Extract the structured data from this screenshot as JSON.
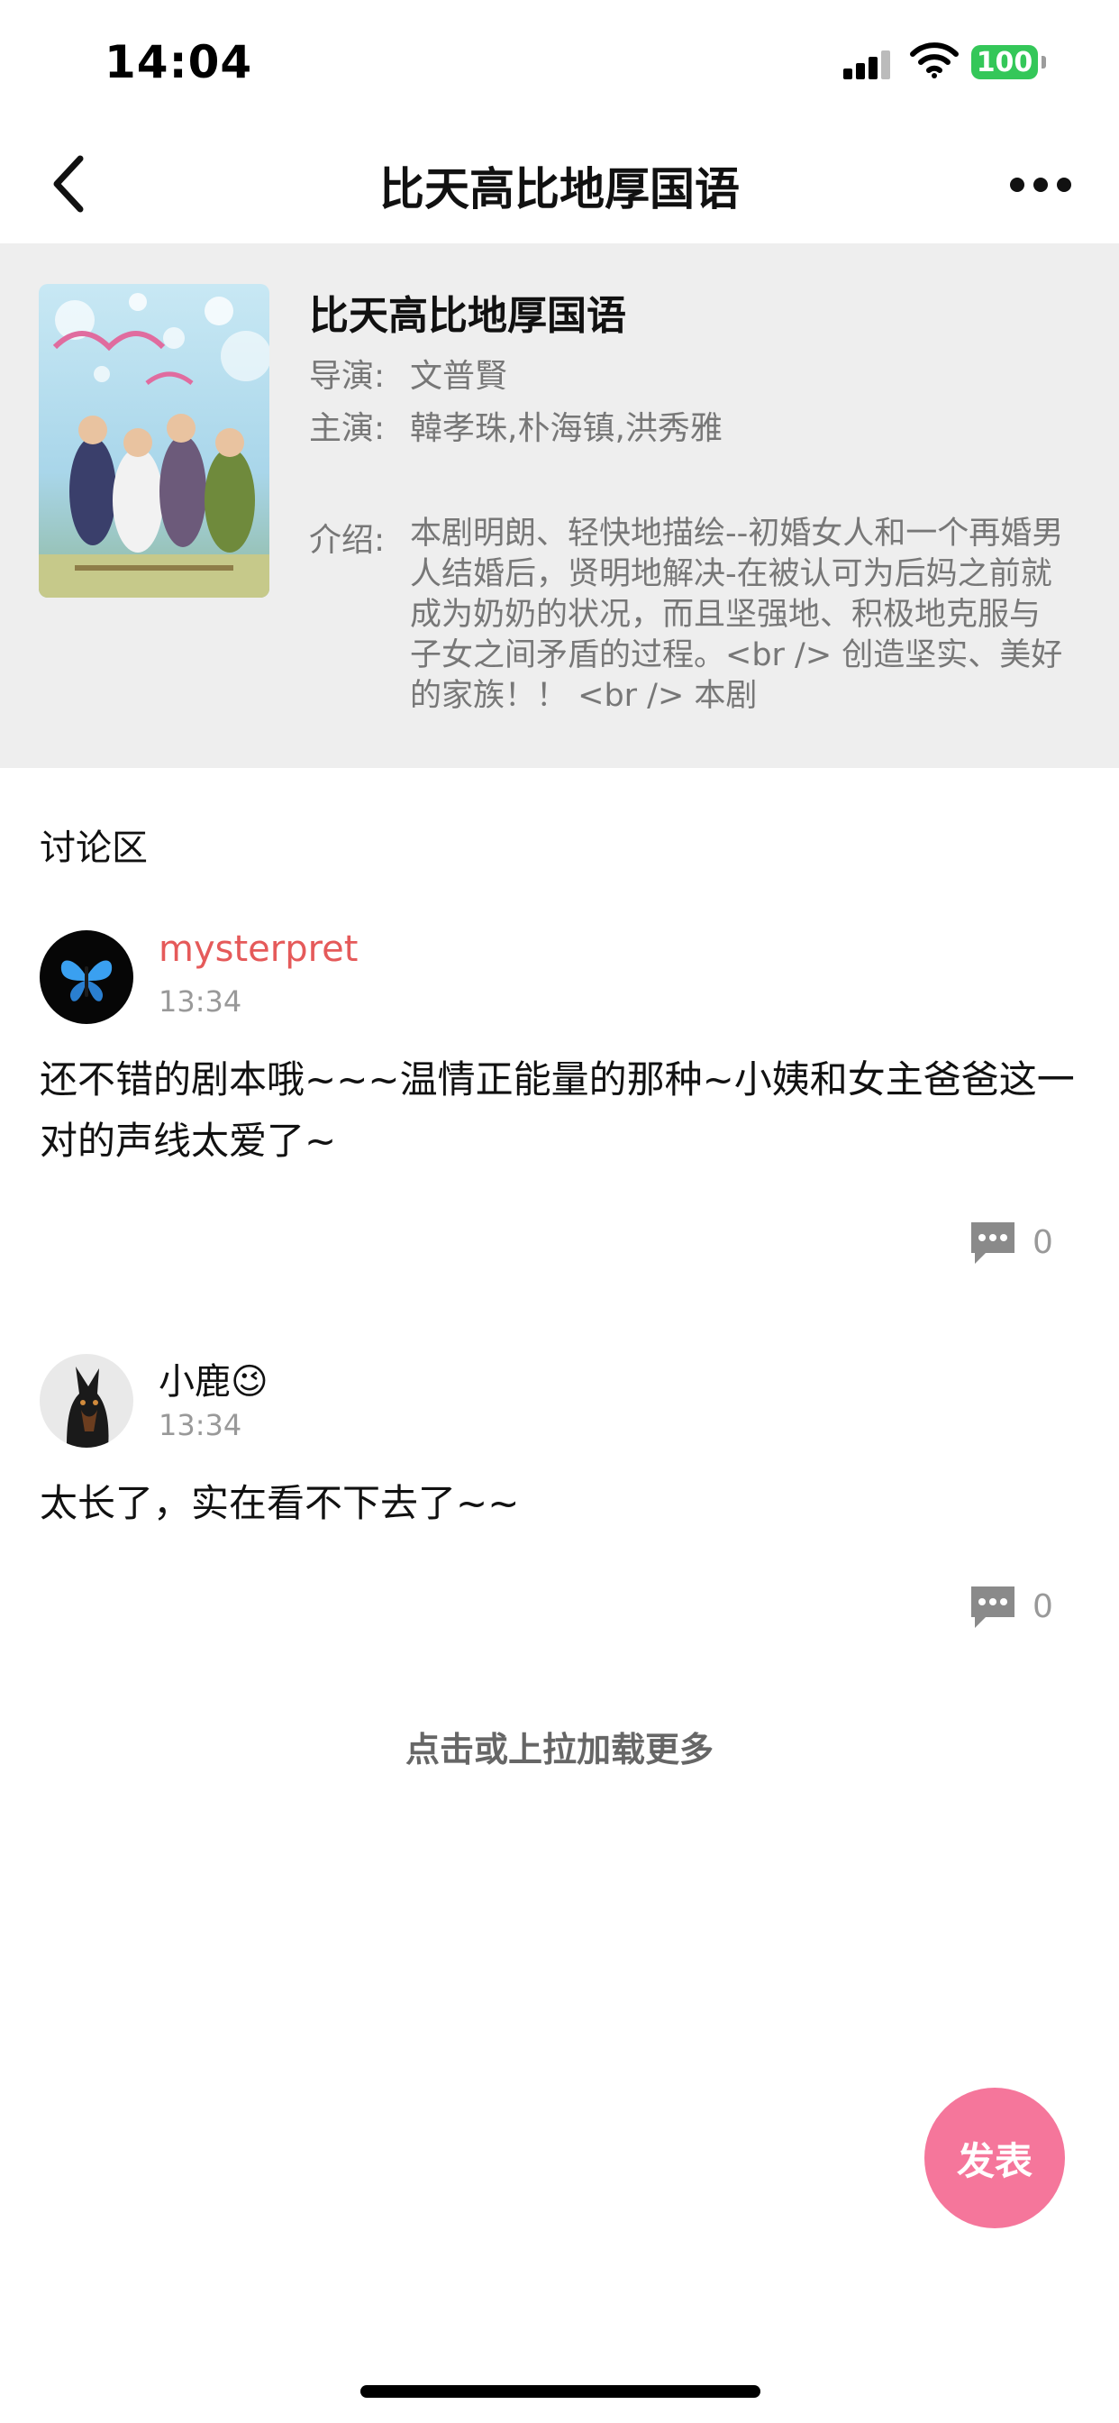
{
  "status_bar": {
    "time": "14:04",
    "battery": "100",
    "icons": [
      "signal-icon",
      "wifi-icon",
      "battery-icon"
    ]
  },
  "nav": {
    "title": "比天高比地厚国语",
    "back_icon": "chevron-left-icon",
    "more_icon": "more-horizontal-icon"
  },
  "drama": {
    "title": "比天高比地厚国语",
    "director_label": "导演:",
    "director": "文普賢",
    "cast_label": "主演:",
    "cast": "韓孝珠,朴海镇,洪秀雅",
    "intro_label": "介绍:",
    "intro": "本剧明朗、轻快地描绘--初婚女人和一个再婚男人结婚后，贤明地解决-在被认可为后妈之前就成为奶奶的状况，而且坚强地、积极地克服与子女之间矛盾的过程。<br /> 创造坚实、美好的家族！！ <br />        本剧"
  },
  "discussion": {
    "title": "讨论区",
    "comments": [
      {
        "user": "mysterpret",
        "user_color": "#e55a5a",
        "time": "13:34",
        "text": "还不错的剧本哦~~~温情正能量的那种~小姨和女主爸爸这一对的声线太爱了~",
        "replies": "0",
        "avatar_icon": "butterfly-avatar"
      },
      {
        "user": "小鹿😉",
        "user_color": "#111111",
        "time": "13:34",
        "text": "太长了，实在看不下去了~~",
        "replies": "0",
        "avatar_icon": "dog-avatar"
      }
    ],
    "load_more": "点击或上拉加载更多"
  },
  "post_button": {
    "label": "发表",
    "color": "#f5769b"
  }
}
